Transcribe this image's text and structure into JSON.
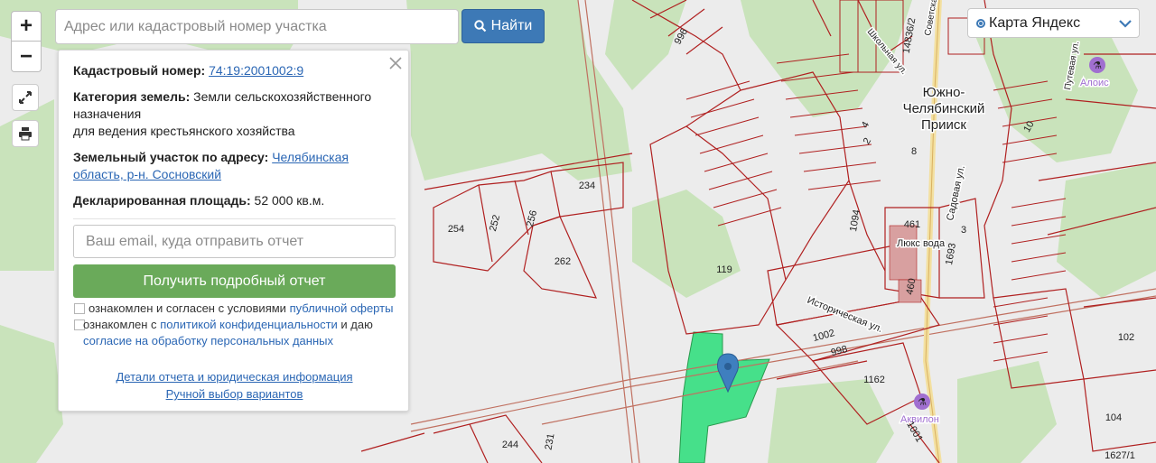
{
  "search": {
    "placeholder": "Адрес или кадастровый номер участка",
    "button_label": "Найти"
  },
  "controls": {
    "zoom_in": "+",
    "zoom_out": "−"
  },
  "layer_selector": {
    "selected": "Карта Яндекс"
  },
  "info_panel": {
    "cadastral_label": "Кадастровый номер:",
    "cadastral_number": "74:19:2001002:9",
    "category_label": "Категория земель:",
    "category_value": "Земли сельскохозяйственного назначения",
    "use_value": "для ведения крестьянского хозяйства",
    "address_label": "Земельный участок по адресу:",
    "address_link": "Челябинская область, р-н. Сосновский",
    "area_label": "Декларированная площадь:",
    "area_value": "52 000 кв.м.",
    "email_placeholder": "Ваш email, куда отправить отчет",
    "report_button": "Получить подробный отчет",
    "offer_text": "ознакомлен и согласен с условиями",
    "offer_link": "публичной оферты",
    "privacy_text_1": "ознакомлен с",
    "privacy_link": "политикой конфиденциальности",
    "privacy_text_2": "и даю",
    "consent_link": "согласие на обработку персональных данных",
    "details_link": "Детали отчета и юридическая информация",
    "manual_link": "Ручной выбор вариантов"
  },
  "map_labels": {
    "settlement": "Южно-\nЧелябинский\nПрииск",
    "street_istoricheskaya": "Историческая ул.",
    "street_sadovaya": "Садовая ул.",
    "street_shkolnaya": "Школьная ул.",
    "street_sovetskaya": "Советская ул.",
    "street_putevaya": "Путевая ул.",
    "poi_alois": "Алоис",
    "poi_akvilon": "Аквилон",
    "poi_luksvoda": "Люкс вода",
    "parcels": [
      "996",
      "14836/2",
      "234",
      "254",
      "252",
      "256",
      "262",
      "119",
      "1094",
      "461",
      "1693",
      "460",
      "1002",
      "998",
      "1162",
      "102",
      "104",
      "1627/1",
      "244",
      "231",
      "10",
      "4",
      "2",
      "8",
      "3",
      "1001"
    ]
  }
}
